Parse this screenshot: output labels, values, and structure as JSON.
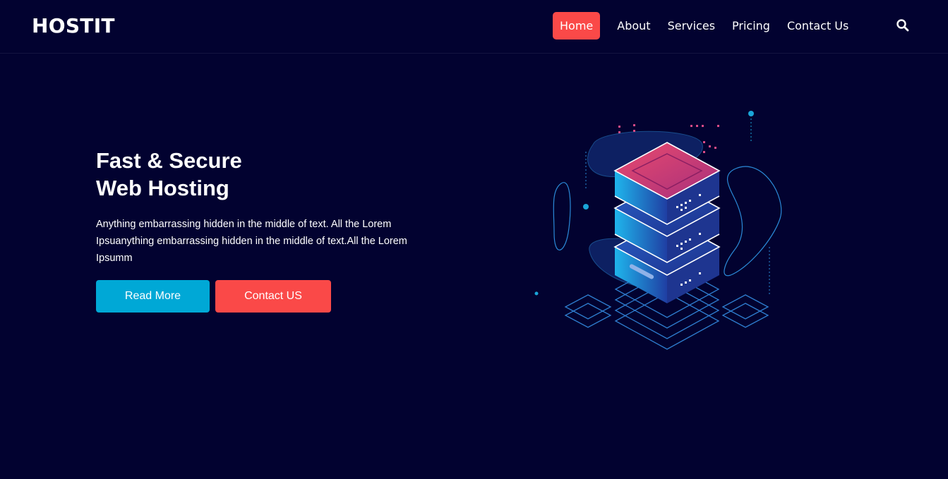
{
  "brand": {
    "name": "HOSTIT"
  },
  "nav": {
    "items": [
      {
        "label": "Home",
        "active": true
      },
      {
        "label": "About",
        "active": false
      },
      {
        "label": "Services",
        "active": false
      },
      {
        "label": "Pricing",
        "active": false
      },
      {
        "label": "Contact Us",
        "active": false
      }
    ],
    "search_icon": "search-icon"
  },
  "hero": {
    "title_line1": "Fast & Secure",
    "title_line2": "Web Hosting",
    "text": "Anything embarrassing hidden in the middle of text. All the Lorem Ipsuanything embarrassing hidden in the middle of text.All the Lorem Ipsumm",
    "read_more": "Read More",
    "contact": "Contact US",
    "illustration_icon": "server-stack-icon"
  },
  "colors": {
    "background": "#020230",
    "accent_red": "#fa4948",
    "accent_blue": "#00a8d6"
  }
}
